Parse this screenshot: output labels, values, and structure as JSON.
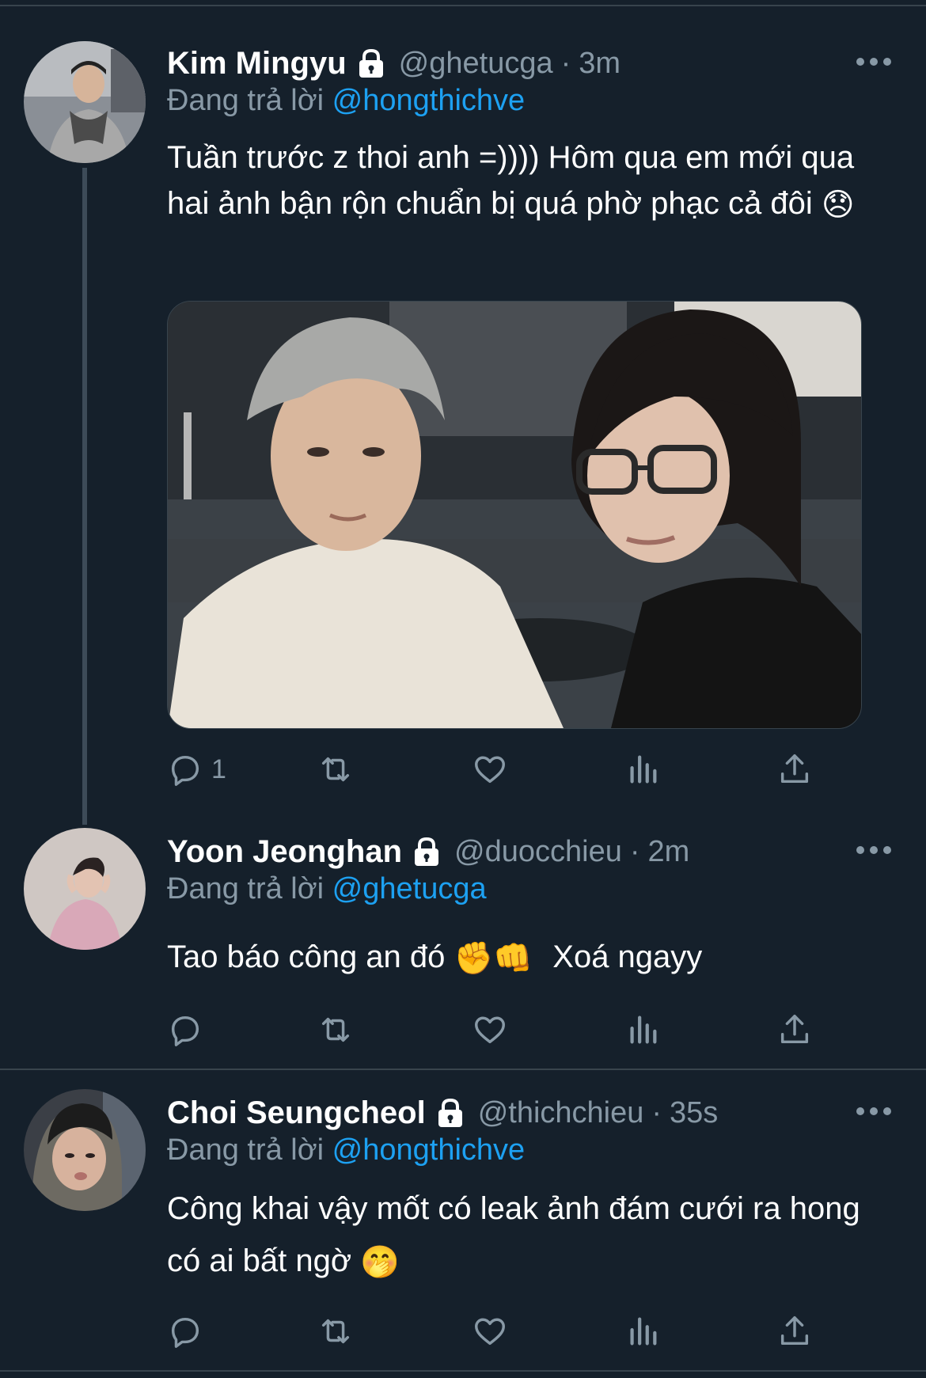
{
  "tweets": [
    {
      "name": "Kim Mingyu",
      "handle": "@ghetucga",
      "time_sep": "·",
      "time": "3m",
      "reply_prefix": "Đang trả lời",
      "reply_to": "@hongthichve",
      "text": "Tuần trước z thoi anh =)))) Hôm qua em mới qua hai ảnh bận rộn chuẩn bị quá phờ phạc cả đôi",
      "emoji": "😞",
      "reply_count": "1",
      "has_media": true
    },
    {
      "name": "Yoon Jeonghan",
      "handle": "@duocchieu",
      "time_sep": "·",
      "time": "2m",
      "reply_prefix": "Đang trả lời",
      "reply_to": "@ghetucga",
      "text": "Tao báo công an đó",
      "emoji": "✊👊",
      "text_after": "Xoá ngayy",
      "reply_count": ""
    },
    {
      "name": "Choi Seungcheol",
      "handle": "@thichchieu",
      "time_sep": "·",
      "time": "35s",
      "reply_prefix": "Đang trả lời",
      "reply_to": "@hongthichve",
      "text": "Công khai vậy mốt có leak ảnh đám cưới ra hong có ai bất ngờ",
      "emoji": "🤭",
      "reply_count": ""
    }
  ],
  "icons": {
    "reply": "reply-icon",
    "retweet": "retweet-icon",
    "like": "heart-icon",
    "analytics": "analytics-icon",
    "share": "share-icon",
    "lock": "lock-icon",
    "more": "more-icon"
  },
  "colors": {
    "background": "#15202b",
    "secondary_text": "#8899a6",
    "link": "#1da1f2",
    "divider": "#38444d"
  }
}
